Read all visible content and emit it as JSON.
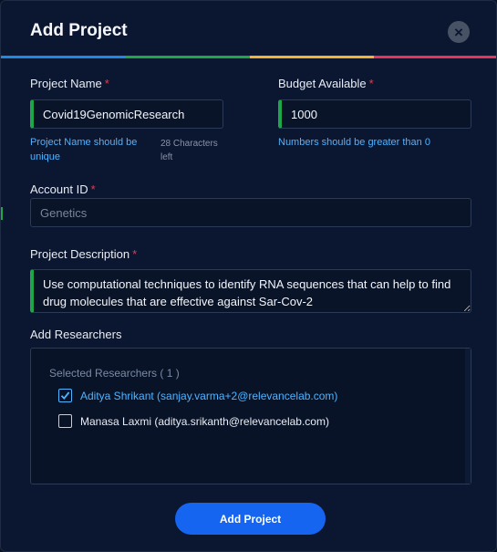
{
  "dialog": {
    "title": "Add Project",
    "close_glyph": "×",
    "stripe_colors": [
      "#1e88e5",
      "#1fa64a",
      "#f2b233",
      "#e8345a"
    ]
  },
  "fields": {
    "project_name": {
      "label": "Project Name",
      "required_mark": "*",
      "value": "Covid19GenomicResearch",
      "hint_line1": "Project Name should be",
      "hint_line2": "unique",
      "chars_line1": "28 Characters",
      "chars_line2": "left"
    },
    "budget": {
      "label": "Budget Available",
      "required_mark": "*",
      "value": "1000",
      "hint": "Numbers should be greater than 0"
    },
    "account_id": {
      "label": "Account ID",
      "required_mark": "*",
      "placeholder": "Genetics"
    },
    "description": {
      "label": "Project Description",
      "required_mark": "*",
      "value": "Use computational techniques to identify RNA sequences that can help to find drug molecules that are effective against Sar-Cov-2"
    }
  },
  "researchers": {
    "label": "Add Researchers",
    "selected_count_text": "Selected Researchers ( 1 )",
    "items": [
      {
        "text": "Aditya Shrikant (sanjay.varma+2@relevancelab.com)",
        "checked": true
      },
      {
        "text": "Manasa Laxmi (aditya.srikanth@relevancelab.com)",
        "checked": false
      }
    ]
  },
  "submit_label": "Add Project",
  "colors": {
    "accent_blue": "#4fb3ff",
    "primary_button": "#1565f0",
    "required_red": "#e53b4f",
    "valid_green": "#1fa64a"
  }
}
